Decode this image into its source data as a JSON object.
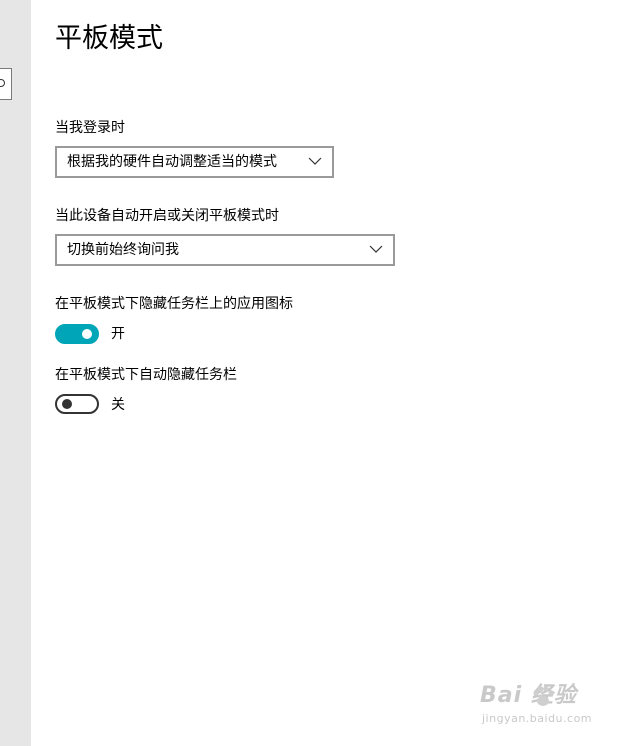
{
  "page": {
    "title": "平板模式"
  },
  "sidebar": {
    "search_icon": "search-icon"
  },
  "settings": {
    "on_signin": {
      "label": "当我登录时",
      "value": "根据我的硬件自动调整适当的模式"
    },
    "auto_switch": {
      "label": "当此设备自动开启或关闭平板模式时",
      "value": "切换前始终询问我"
    },
    "hide_app_icons": {
      "label": "在平板模式下隐藏任务栏上的应用图标",
      "state": "开",
      "on": true
    },
    "auto_hide_taskbar": {
      "label": "在平板模式下自动隐藏任务栏",
      "state": "关",
      "on": false
    }
  },
  "colors": {
    "accent": "#00a6b8",
    "sidebar_bg": "#e6e6e6"
  },
  "watermark": {
    "logo": "Bai 经验",
    "url": "jingyan.baidu.com"
  }
}
